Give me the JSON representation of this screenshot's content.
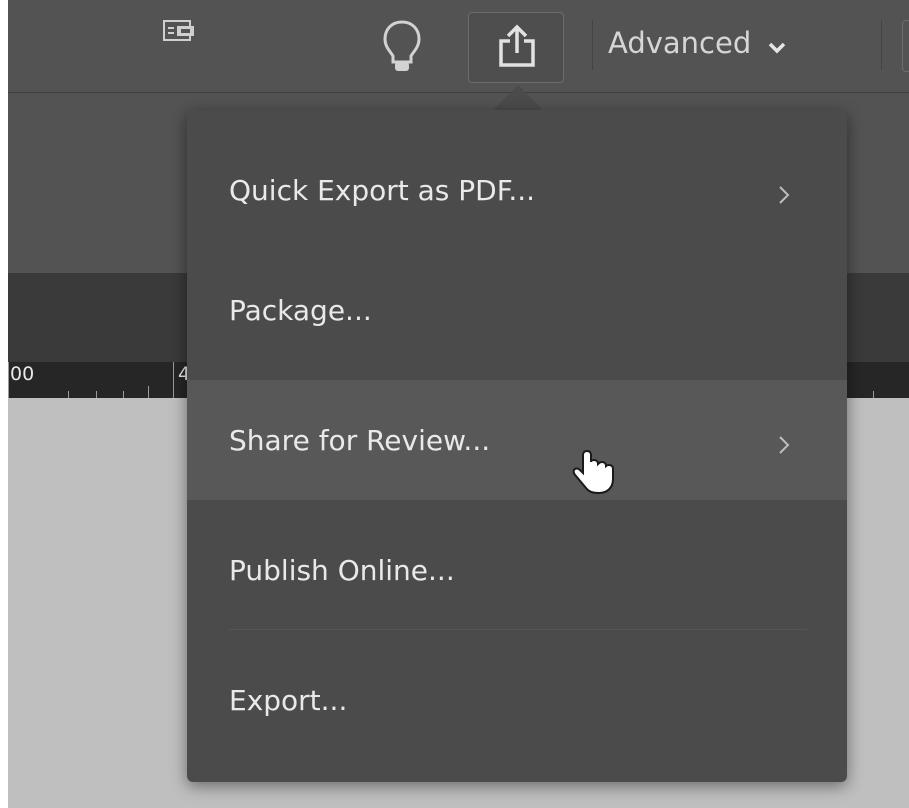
{
  "toolbar": {
    "screen_mode_icon": "screen-mode-icon",
    "tips_icon": "lightbulb-icon",
    "share_icon": "share-icon",
    "workspace_label": "Advanced",
    "workspace_chevron_icon": "chevron-down-icon"
  },
  "ruler": {
    "labels": [
      "00",
      "4"
    ]
  },
  "share_menu": {
    "items": [
      {
        "label": "Quick Export as PDF...",
        "has_submenu": true,
        "submenu_icon": "chevron-right-icon"
      },
      {
        "label": "Package...",
        "has_submenu": false
      },
      {
        "label": "Share for Review...",
        "has_submenu": true,
        "submenu_icon": "chevron-right-icon",
        "state": "hover"
      },
      {
        "label": "Publish Online...",
        "has_submenu": false
      },
      {
        "label": "Export...",
        "has_submenu": false
      }
    ]
  },
  "cursor": {
    "icon": "hand-pointer-icon"
  },
  "colors": {
    "toolbar_bg": "#535353",
    "menu_bg": "#4b4b4b",
    "menu_hover_bg": "#585858",
    "menu_text": "#e9e9e9",
    "ruler_bg": "#262626",
    "pasteboard_bg": "#bfbfbf"
  }
}
